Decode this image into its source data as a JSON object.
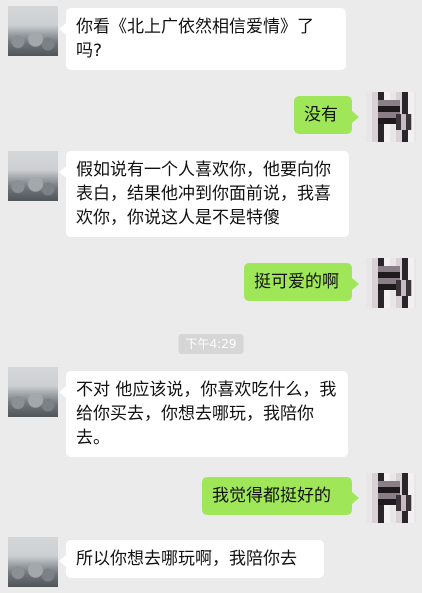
{
  "timestamp": "下午4:29",
  "messages": [
    {
      "side": "left",
      "text": "你看《北上广依然相信爱情》了吗?"
    },
    {
      "side": "right",
      "text": "没有"
    },
    {
      "side": "left",
      "text": "假如说有一个人喜欢你，他要向你表白，结果他冲到你面前说，我喜欢你，你说这人是不是特傻"
    },
    {
      "side": "right",
      "text": "挺可爱的啊"
    },
    {
      "side": "left",
      "text": "不对 他应该说，你喜欢吃什么，我给你买去，你想去哪玩，我陪你去。"
    },
    {
      "side": "right",
      "text": "我觉得都挺好的"
    },
    {
      "side": "left",
      "text": "所以你想去哪玩啊，我陪你去"
    }
  ],
  "colors": {
    "incoming_bubble": "#ffffff",
    "outgoing_bubble": "#9fe658",
    "background": "#ebebeb"
  }
}
